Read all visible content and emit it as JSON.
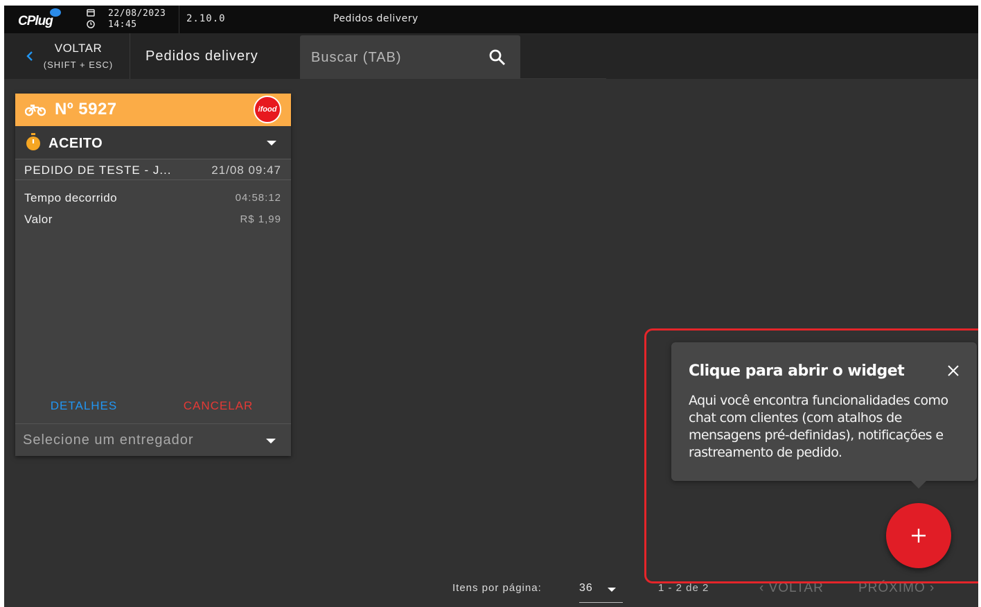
{
  "topbar": {
    "logo_text": "CPlug",
    "date": "22/08/2023",
    "time": "14:45",
    "version": "2.10.0",
    "title": "Pedidos delivery"
  },
  "navbar": {
    "back_label": "VOLTAR",
    "back_shortcut": "(SHIFT + ESC)",
    "page_heading": "Pedidos delivery",
    "search_placeholder": "Buscar (TAB)"
  },
  "order_card": {
    "number": "Nº 5927",
    "platform_badge": "ifood",
    "status": "ACEITO",
    "customer": "PEDIDO DE TESTE - J...",
    "order_date": "21/08 09:47",
    "elapsed_label": "Tempo decorrido",
    "elapsed_value": "04:58:12",
    "value_label": "Valor",
    "value_amount": "R$ 1,99",
    "details_button": "DETALHES",
    "cancel_button": "CANCELAR",
    "driver_placeholder": "Selecione um entregador",
    "colors": {
      "header": "#fbac47",
      "details": "#2196f3",
      "cancel": "#e53935"
    }
  },
  "pagination": {
    "items_per_page_label": "Itens por página:",
    "items_per_page_value": "36",
    "range": "1 - 2 de 2",
    "prev_label": "VOLTAR",
    "next_label": "PRÓXIMO"
  },
  "widget_tooltip": {
    "title": "Clique para abrir o widget",
    "body": "Aqui você encontra funcionalidades como chat com clientes (com atalhos de mensagens pré-definidas), notificações e rastreamento de pedido.",
    "close_icon": "close-icon",
    "fab_icon": "plus-icon",
    "accent_color": "#e11d26"
  }
}
